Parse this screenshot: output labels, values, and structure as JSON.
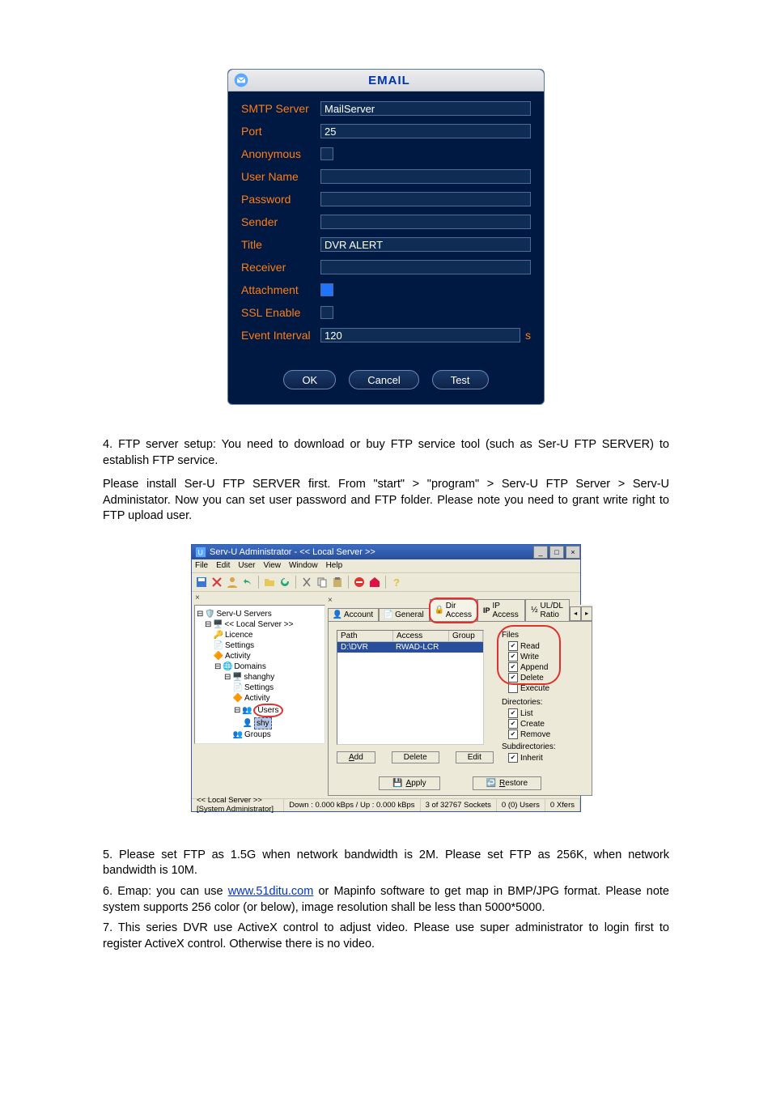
{
  "email_dialog": {
    "title": "EMAIL",
    "fields": {
      "smtp_label": "SMTP Server",
      "smtp_value": "MailServer",
      "port_label": "Port",
      "port_value": "25",
      "anonymous_label": "Anonymous",
      "username_label": "User Name",
      "username_value": "",
      "password_label": "Password",
      "password_value": "",
      "sender_label": "Sender",
      "sender_value": "",
      "title_label": "Title",
      "title_value": "DVR ALERT",
      "receiver_label": "Receiver",
      "receiver_value": "",
      "attachment_label": "Attachment",
      "ssl_label": "SSL Enable",
      "interval_label": "Event Interval",
      "interval_value": "120",
      "interval_unit": "s"
    },
    "buttons": {
      "ok": "OK",
      "cancel": "Cancel",
      "test": "Test"
    }
  },
  "text": {
    "para1": "4. FTP server setup: You need to download or buy FTP service tool (such as Ser-U FTP SERVER) to establish FTP service.",
    "step_a_prefix": "Please install Ser-U FTP SERVER first. From \"start\"  > \"program\"",
    "step_a_suffix": " > Serv-U FTP Server > Serv-U Administator. Now you can set user password and FTP folder. Please note you need to grant write right to FTP upload user.",
    "para2": "5. Please set FTP as 1.5G when network bandwidth is 2M. Please set FTP as 256K, when network bandwidth is 10M.",
    "para3_prefix": "6. Emap: you can use ",
    "para3_link_text": "www.51ditu.com",
    "para3_link_href": "http://www.51ditu.com",
    "para3_suffix": " or Mapinfo software to get map in BMP/JPG format. Please note system supports 256 color (or below), image resolution shall be less than 5000*5000.",
    "para4": "7. This series DVR use ActiveX control to adjust video. Please use super administrator to login first to register ActiveX control. Otherwise there is no video."
  },
  "servu": {
    "title": "Serv-U Administrator - << Local Server >>",
    "menu": [
      "File",
      "Edit",
      "User",
      "View",
      "Window",
      "Help"
    ],
    "tree": {
      "root": "Serv-U Servers",
      "local": "<< Local Server >>",
      "license": "Licence",
      "settings": "Settings",
      "activity": "Activity",
      "domains": "Domains",
      "domain1": "shanghy",
      "d_settings": "Settings",
      "d_activity": "Activity",
      "users": "Users",
      "user1": "shy",
      "groups": "Groups"
    },
    "tabs": {
      "account": "Account",
      "general": "General",
      "diraccess": "Dir Access",
      "ipaccess": "IP Access",
      "uldl": "UL/DL Ratio"
    },
    "tab_icons": {
      "account": "person-icon",
      "general": "page-icon",
      "diraccess": "lock-icon",
      "ipaccess": "ip-icon",
      "uldl": "ratio-icon"
    },
    "list": {
      "h_path": "Path",
      "h_access": "Access",
      "h_group": "Group",
      "r_path": "D:\\DVR",
      "r_access": "RWAD-LCR"
    },
    "perms": {
      "files_label": "Files",
      "read": "Read",
      "write": "Write",
      "append": "Append",
      "delete": "Delete",
      "execute": "Execute",
      "dirs_label": "Directories:",
      "list": "List",
      "create": "Create",
      "remove": "Remove",
      "subdirs_label": "Subdirectories:",
      "inherit": "Inherit"
    },
    "btns": {
      "add": "Add",
      "delete": "Delete",
      "edit": "Edit",
      "apply": "Apply",
      "restore": "Restore"
    },
    "status": {
      "left": "<< Local Server >>   [System Administrator]",
      "mid": "Down : 0.000 kBps / Up : 0.000 kBps",
      "sockets": "3 of 32767 Sockets",
      "users": "0 (0) Users",
      "xfers": "0 Xfers"
    },
    "win_btns": {
      "min": "_",
      "max": "□",
      "close": "×"
    }
  }
}
